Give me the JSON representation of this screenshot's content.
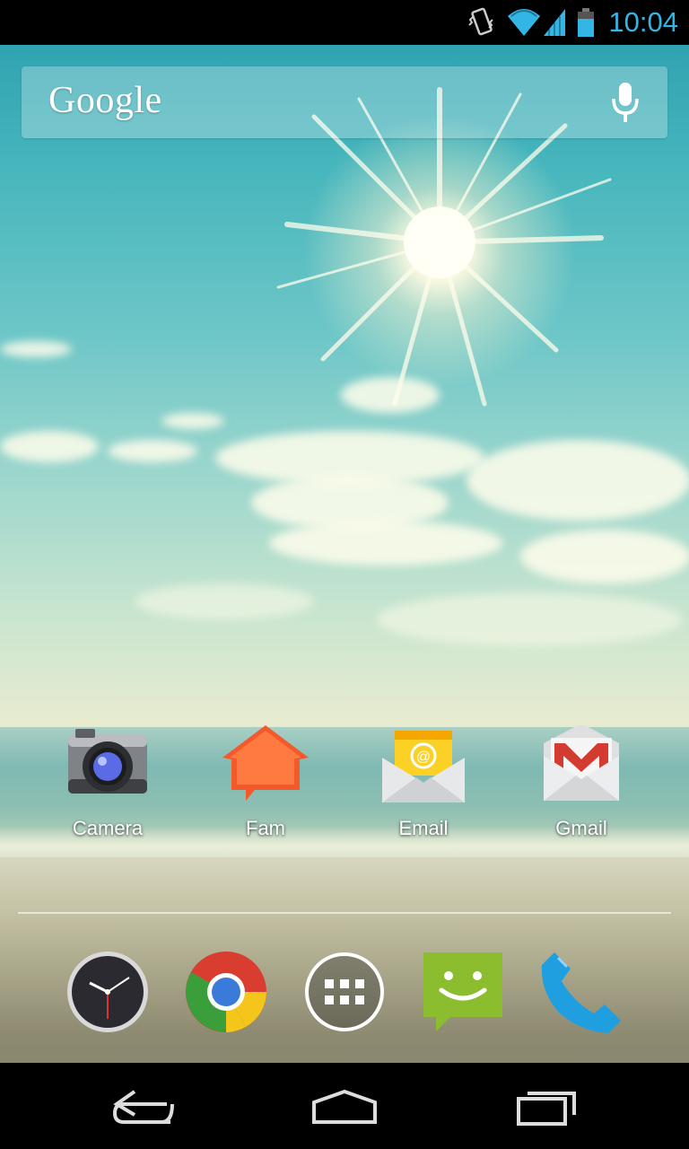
{
  "status_bar": {
    "time": "10:04",
    "icons": [
      "vibrate-icon",
      "wifi-icon",
      "cell-signal-icon",
      "battery-icon"
    ],
    "accent_color": "#33b5e5"
  },
  "search": {
    "logo_text": "Google",
    "mic_icon": "mic-icon"
  },
  "home_apps": [
    {
      "label": "Camera",
      "icon": "camera-icon"
    },
    {
      "label": "Fam",
      "icon": "fam-icon"
    },
    {
      "label": "Email",
      "icon": "email-icon"
    },
    {
      "label": "Gmail",
      "icon": "gmail-icon"
    }
  ],
  "dock": [
    {
      "name": "Clock",
      "icon": "clock-icon"
    },
    {
      "name": "Chrome",
      "icon": "chrome-icon"
    },
    {
      "name": "Apps",
      "icon": "app-drawer-icon"
    },
    {
      "name": "Messaging",
      "icon": "messaging-icon"
    },
    {
      "name": "Phone",
      "icon": "phone-icon"
    }
  ],
  "nav_bar": [
    "back-icon",
    "home-icon",
    "recent-apps-icon"
  ]
}
